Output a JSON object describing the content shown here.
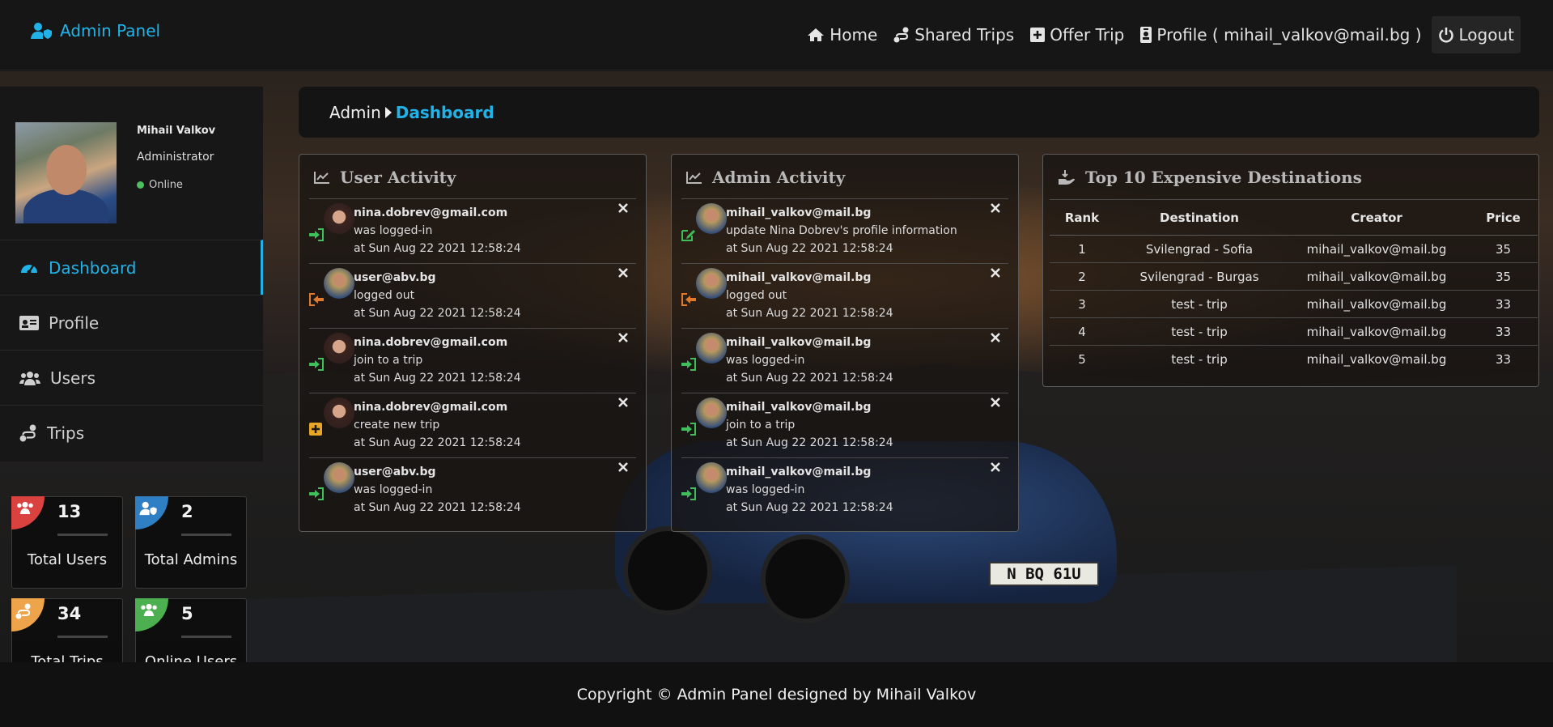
{
  "brand": {
    "title": "Admin Panel",
    "icon": "user-shield-icon"
  },
  "nav": {
    "home": "Home",
    "shared_trips": "Shared Trips",
    "offer_trip": "Offer Trip",
    "profile": "Profile ( mihail_valkov@mail.bg )",
    "logout": "Logout"
  },
  "user": {
    "name": "Mihail Valkov",
    "role": "Administrator",
    "status": "Online"
  },
  "menu": [
    {
      "label": "Dashboard",
      "icon": "tachometer-icon"
    },
    {
      "label": "Profile",
      "icon": "id-card-icon"
    },
    {
      "label": "Users",
      "icon": "users-icon"
    },
    {
      "label": "Trips",
      "icon": "route-icon"
    }
  ],
  "stats": [
    {
      "value": "13",
      "label": "Total Users",
      "color": "#d9423f",
      "icon": "users-icon"
    },
    {
      "value": "2",
      "label": "Total Admins",
      "color": "#2f7fc4",
      "icon": "user-shield-icon"
    },
    {
      "value": "34",
      "label": "Total Trips",
      "color": "#eea44a",
      "icon": "route-icon"
    },
    {
      "value": "5",
      "label": "Online Users",
      "color": "#4caf50",
      "icon": "users-icon"
    }
  ],
  "breadcrumb": {
    "parent": "Admin",
    "current": "Dashboard"
  },
  "user_activity": {
    "title": "User Activity",
    "items": [
      {
        "email": "nina.dobrev@gmail.com",
        "action": "was logged-in",
        "time": "at Sun Aug 22 2021 12:58:24",
        "type": "login",
        "avatar": "female"
      },
      {
        "email": "user@abv.bg",
        "action": "logged out",
        "time": "at Sun Aug 22 2021 12:58:24",
        "type": "logout",
        "avatar": "male"
      },
      {
        "email": "nina.dobrev@gmail.com",
        "action": "join to a trip",
        "time": "at Sun Aug 22 2021 12:58:24",
        "type": "login",
        "avatar": "female"
      },
      {
        "email": "nina.dobrev@gmail.com",
        "action": "create new trip",
        "time": "at Sun Aug 22 2021 12:58:24",
        "type": "create",
        "avatar": "female"
      },
      {
        "email": "user@abv.bg",
        "action": "was logged-in",
        "time": "at Sun Aug 22 2021 12:58:24",
        "type": "login",
        "avatar": "male"
      }
    ]
  },
  "admin_activity": {
    "title": "Admin Activity",
    "items": [
      {
        "email": "mihail_valkov@mail.bg",
        "action": "update Nina Dobrev's profile information",
        "time": "at Sun Aug 22 2021 12:58:24",
        "type": "edit",
        "avatar": "male"
      },
      {
        "email": "mihail_valkov@mail.bg",
        "action": "logged out",
        "time": "at Sun Aug 22 2021 12:58:24",
        "type": "logout",
        "avatar": "male"
      },
      {
        "email": "mihail_valkov@mail.bg",
        "action": "was logged-in",
        "time": "at Sun Aug 22 2021 12:58:24",
        "type": "login",
        "avatar": "male"
      },
      {
        "email": "mihail_valkov@mail.bg",
        "action": "join to a trip",
        "time": "at Sun Aug 22 2021 12:58:24",
        "type": "login",
        "avatar": "male"
      },
      {
        "email": "mihail_valkov@mail.bg",
        "action": "was logged-in",
        "time": "at Sun Aug 22 2021 12:58:24",
        "type": "login",
        "avatar": "male"
      }
    ]
  },
  "top_destinations": {
    "title": "Top 10 Expensive Destinations",
    "columns": [
      "Rank",
      "Destination",
      "Creator",
      "Price"
    ],
    "rows": [
      [
        "1",
        "Svilengrad - Sofia",
        "mihail_valkov@mail.bg",
        "35"
      ],
      [
        "2",
        "Svilengrad - Burgas",
        "mihail_valkov@mail.bg",
        "35"
      ],
      [
        "3",
        "test - trip",
        "mihail_valkov@mail.bg",
        "33"
      ],
      [
        "4",
        "test - trip",
        "mihail_valkov@mail.bg",
        "33"
      ],
      [
        "5",
        "test - trip",
        "mihail_valkov@mail.bg",
        "33"
      ]
    ]
  },
  "car_plate": "N BQ 61U",
  "footer": {
    "text": "Copyright © Admin Panel designed by Mihail Valkov"
  },
  "colors": {
    "accent": "#21b3e8",
    "login": "#3fbf5a",
    "logout": "#e07a2c",
    "create": "#e9a526"
  }
}
